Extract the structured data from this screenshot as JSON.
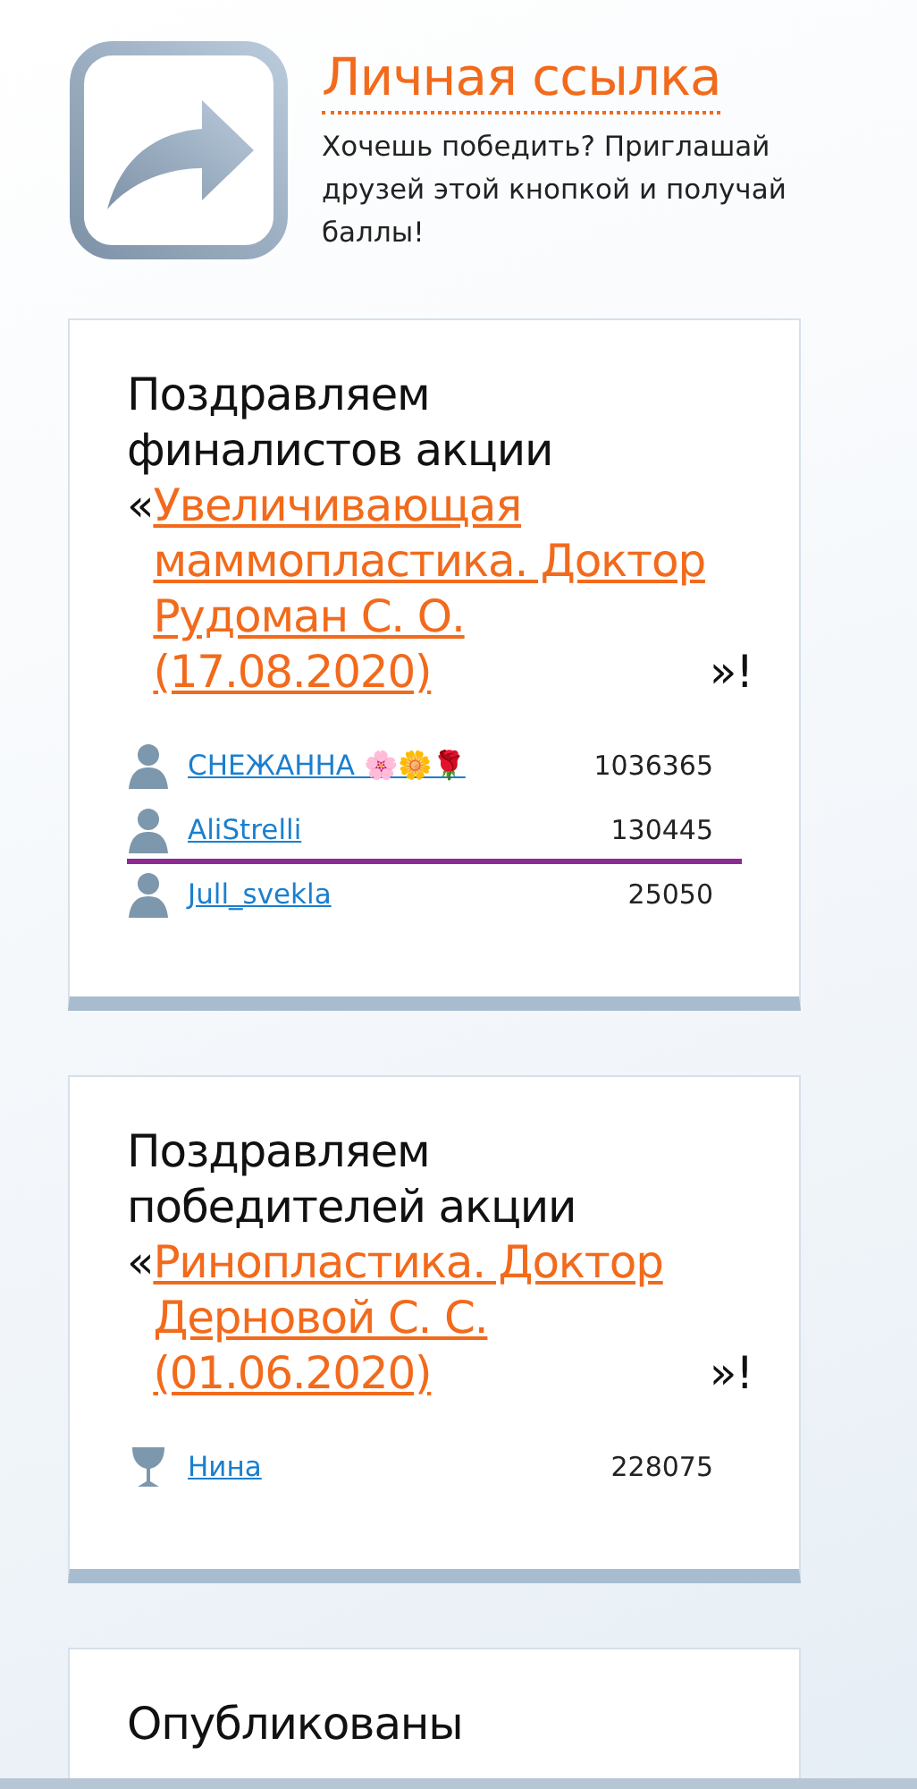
{
  "promo": {
    "title": "Личная ссылка",
    "text": "Хочешь победить? Приглашай друзей этой кнопкой и получай баллы!"
  },
  "cards": [
    {
      "title_before": "Поздравляем финалистов акции",
      "title_open": "«",
      "title_link": "Увеличивающая маммопластика. Доктор Рудоман С. О. (17.08.2020)",
      "title_after": "»!",
      "rows": [
        {
          "kind": "person",
          "name": "СНЕЖАННА 🌸🌼🌹",
          "score": "1036365",
          "line_below": false
        },
        {
          "kind": "person",
          "name": "AliStrelli",
          "score": "130445",
          "line_below": true
        },
        {
          "kind": "person",
          "name": "Jull_svekla",
          "score": "25050",
          "line_below": false
        }
      ]
    },
    {
      "title_before": "Поздравляем победителей акции",
      "title_open": "«",
      "title_link": "Ринопластика. Доктор Дерновой С. С. (01.06.2020)",
      "title_after": "»!",
      "rows": [
        {
          "kind": "trophy",
          "name": "Нина",
          "score": "228075",
          "line_below": false
        }
      ]
    },
    {
      "title_before": "Опубликованы"
    }
  ]
}
